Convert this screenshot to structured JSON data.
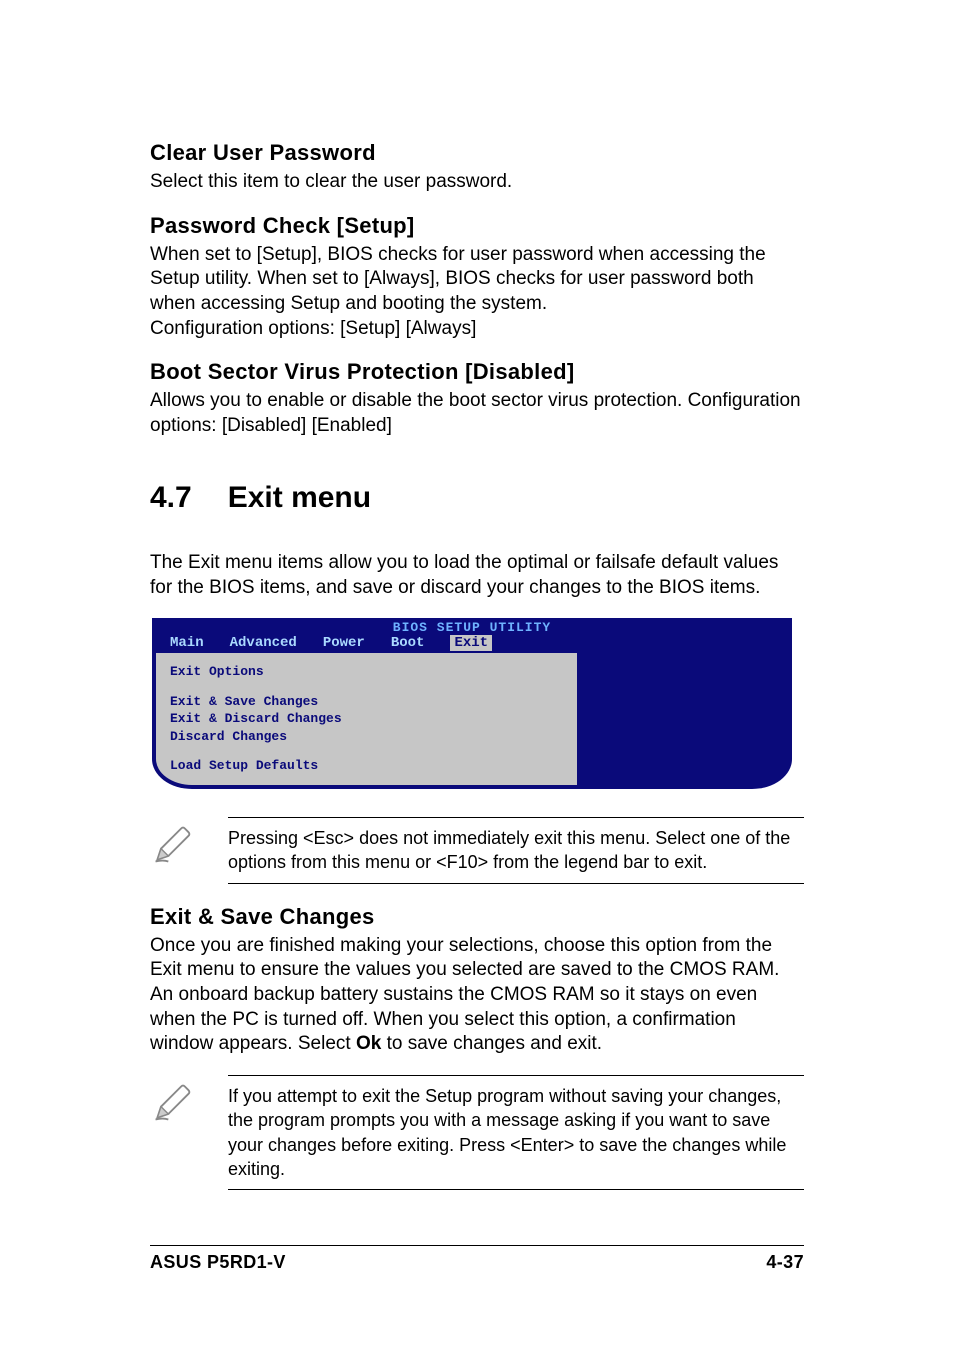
{
  "section1": {
    "heading": "Clear User Password",
    "body": "Select this item to clear the user password."
  },
  "section2": {
    "heading": "Password Check [Setup]",
    "body": "When set to [Setup], BIOS checks for user password when accessing the Setup utility. When set to [Always], BIOS checks for user password both when accessing Setup and booting the system.\nConfiguration options: [Setup] [Always]"
  },
  "section3": {
    "heading": "Boot Sector Virus Protection [Disabled]",
    "body": "Allows you to enable or disable the boot sector virus protection. Configuration options: [Disabled] [Enabled]"
  },
  "main_heading": {
    "num": "4.7",
    "title": "Exit menu"
  },
  "intro_body": "The Exit menu items allow you to load the optimal or failsafe default values for the BIOS items, and save or discard your changes to the BIOS items.",
  "bios": {
    "title": "BIOS SETUP UTILITY",
    "tabs": [
      "Main",
      "Advanced",
      "Power",
      "Boot",
      "Exit"
    ],
    "selected_tab": "Exit",
    "panel_title": "Exit Options",
    "items": [
      "Exit & Save Changes",
      "Exit & Discard Changes",
      "Discard Changes",
      "",
      "Load Setup Defaults"
    ]
  },
  "note1": "Pressing <Esc> does not immediately exit this menu. Select one of the options from this menu or <F10> from the legend bar to exit.",
  "section4": {
    "heading": "Exit & Save Changes",
    "body_before": "Once you are finished making your selections, choose this option from the Exit menu to ensure the values you selected are saved to the CMOS RAM. An onboard backup battery sustains the CMOS RAM so it stays on even when the PC is turned off. When you select this option, a confirmation window appears. Select ",
    "bold": "Ok",
    "body_after": " to save changes and exit."
  },
  "note2": " If you attempt to exit the Setup program without saving your changes, the program prompts you with a message asking if you want to save your changes before exiting. Press <Enter>  to save the  changes while exiting.",
  "footer": {
    "left": "ASUS P5RD1-V",
    "right": "4-37"
  }
}
